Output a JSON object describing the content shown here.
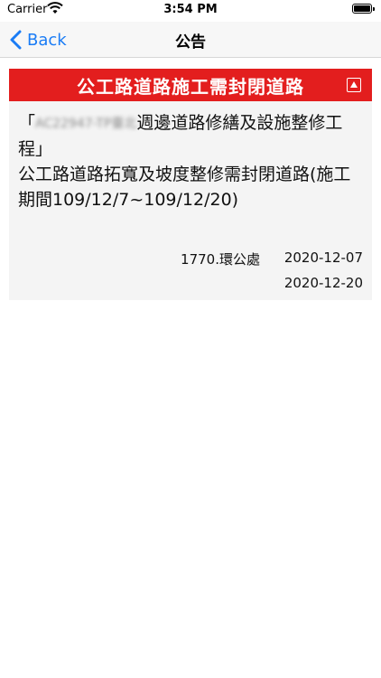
{
  "status_bar": {
    "carrier": "Carrier",
    "time": "3:54 PM"
  },
  "nav": {
    "back_label": "Back",
    "title": "公告"
  },
  "announcement": {
    "header_title": "公工路道路施工需封閉道路",
    "quote_open": "「",
    "redacted_id": "AC22947-TP臺北",
    "line1_rest": "週邊道路修繕及設施整修工程」",
    "line2": "公工路道路拓寬及坡度整修需封閉道路(施工期間109/12/7~109/12/20)",
    "office": "1770.環公處",
    "start_date": "2020-12-07",
    "end_date": "2020-12-20"
  },
  "colors": {
    "accent_red": "#e31e1e",
    "link_blue": "#1a7cf5"
  }
}
